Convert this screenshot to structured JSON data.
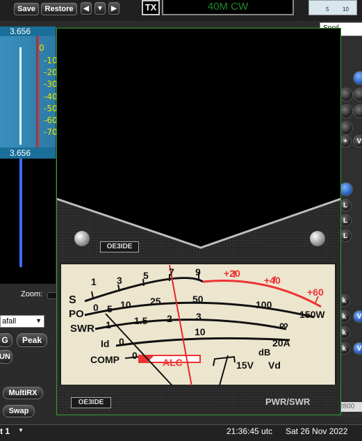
{
  "toolbar": {
    "save_label": "Save",
    "restore_label": "Restore"
  },
  "tx": {
    "label": "TX",
    "band_mode": "40M CW"
  },
  "mini_scale": {
    "v1": "5",
    "v2": "10"
  },
  "right_panel": {
    "top_select": "Spcrl",
    "side_letters": [
      "k",
      "k",
      "k",
      "k"
    ],
    "l_letters": [
      "L",
      "L",
      "L"
    ],
    "plus": "+",
    "v1": "V",
    "v2": "V",
    "v3": "V",
    "spin_value": "2800"
  },
  "panadapter": {
    "freq_top": "3.656",
    "freq_bottom": "3.656",
    "db_scale": [
      "0",
      "-10",
      "-20",
      "-30",
      "-40",
      "-50",
      "-60",
      "-70"
    ]
  },
  "left_controls": {
    "zoom_label": "Zoom:",
    "waterfall_select": "afall",
    "g_label": "G",
    "peak_label": "Peak",
    "un_label": "UN",
    "multirx_label": "MultiRX",
    "swap_label": "Swap"
  },
  "meter": {
    "brand_top": "OE3IDE",
    "brand_bottom": "OE3IDE",
    "caption": "PWR/SWR",
    "row_labels": {
      "s": "S",
      "po": "PO",
      "swr": "SWR",
      "id": "Id",
      "comp": "COMP",
      "alc": "ALC",
      "vd": "Vd",
      "db": "dB"
    },
    "s_ticks": [
      "1",
      "3",
      "5",
      "7",
      "9",
      "+20",
      "+40",
      "+60"
    ],
    "po_ticks": [
      "0",
      "5",
      "10",
      "25",
      "50",
      "100",
      "150W"
    ],
    "swr_ticks": [
      "1",
      "1.5",
      "2",
      "3",
      "∞"
    ],
    "id_ticks": [
      "0",
      "10",
      "20A"
    ],
    "comp_ticks": [
      "0",
      "15V"
    ],
    "needle_angle_deg": 8
  },
  "status_bar": {
    "left": "t 1",
    "time": "21:36:45 utc",
    "date": "Sat 26 Nov 2022"
  }
}
